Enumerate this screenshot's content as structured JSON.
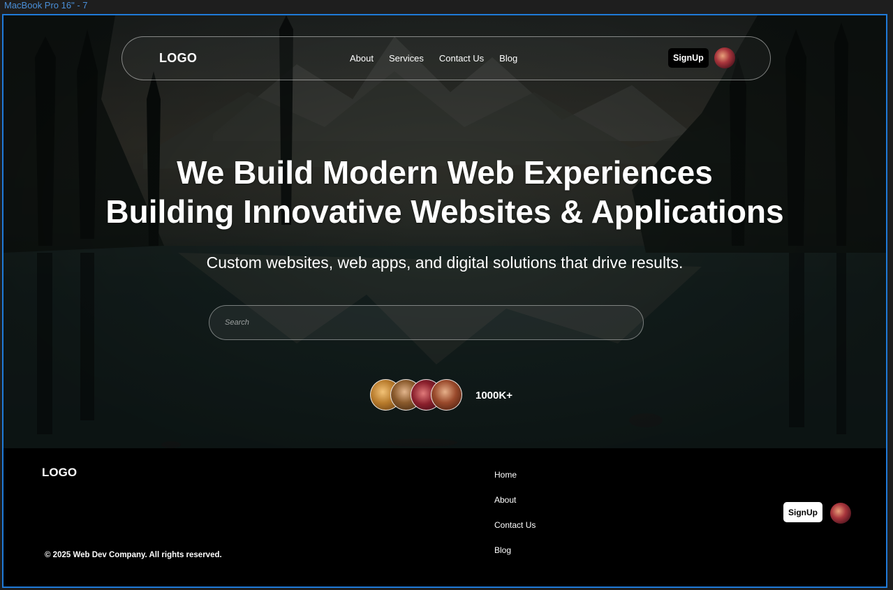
{
  "canvas": {
    "frame_label": "MacBook Pro 16\" - 7"
  },
  "nav": {
    "logo": "LOGO",
    "links": [
      "About",
      "Services",
      "Contact Us",
      "Blog"
    ],
    "signup": "SignUp"
  },
  "hero": {
    "title_line1": "We Build Modern Web Experiences",
    "title_line2": "Building Innovative Websites & Applications",
    "subtitle": "Custom websites, web apps, and digital solutions that drive results.",
    "search_placeholder": "Search",
    "user_count": "1000K+"
  },
  "footer": {
    "logo": "LOGO",
    "links": [
      "Home",
      "About",
      "Contact Us",
      "Blog"
    ],
    "copyright": "© 2025 Web Dev Company. All rights reserved.",
    "signup": "SignUp"
  },
  "colors": {
    "frame_border": "#1f7ad8",
    "footer_bg": "#000000",
    "nav_button_bg": "#000000",
    "footer_button_bg": "#ffffff"
  }
}
